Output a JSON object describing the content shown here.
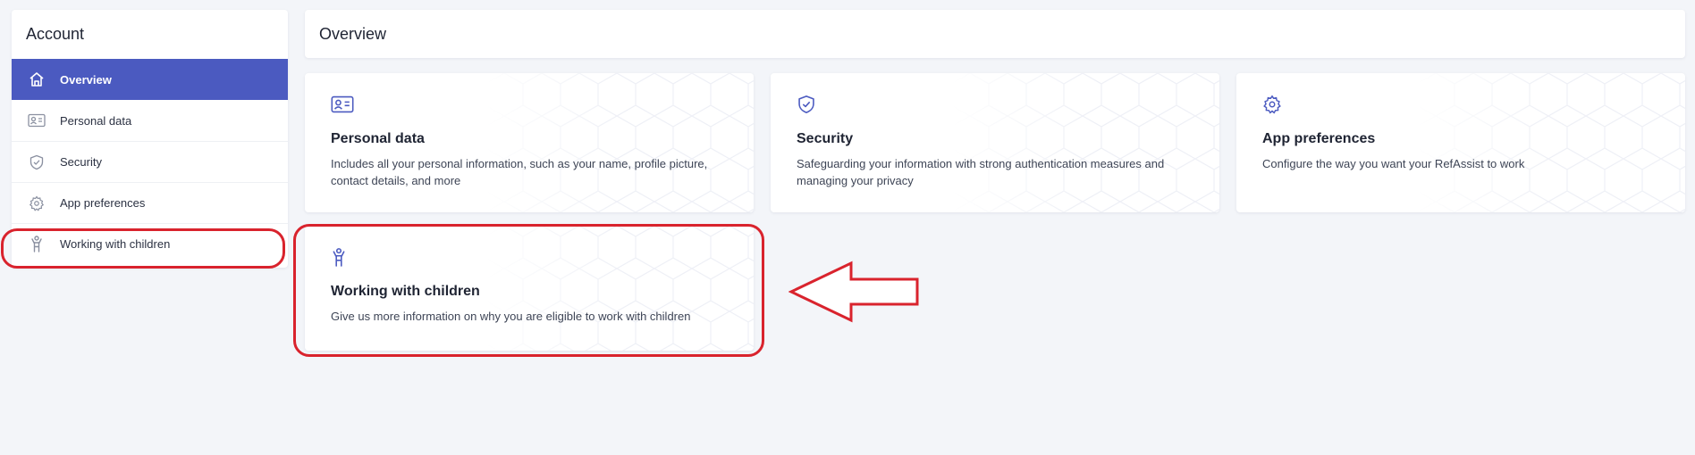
{
  "sidebar": {
    "title": "Account",
    "items": [
      {
        "label": "Overview",
        "icon": "home-icon",
        "active": true
      },
      {
        "label": "Personal data",
        "icon": "id-card-icon",
        "active": false
      },
      {
        "label": "Security",
        "icon": "shield-check-icon",
        "active": false
      },
      {
        "label": "App preferences",
        "icon": "gear-icon",
        "active": false
      },
      {
        "label": "Working with children",
        "icon": "child-icon",
        "active": false
      }
    ]
  },
  "header": {
    "title": "Overview"
  },
  "cards": [
    {
      "title": "Personal data",
      "description": "Includes all your personal information, such as your name, profile picture, contact details, and more",
      "icon": "id-card-icon"
    },
    {
      "title": "Security",
      "description": "Safeguarding your information with strong authentication measures and managing your privacy",
      "icon": "shield-check-icon"
    },
    {
      "title": "App preferences",
      "description": "Configure the way you want your RefAssist to work",
      "icon": "gear-icon"
    },
    {
      "title": "Working with children",
      "description": "Give us more information on why you are eligible to work with children",
      "icon": "child-icon"
    }
  ],
  "colors": {
    "accent": "#4b5ac0",
    "annotation": "#d9232d",
    "background": "#f3f5f9"
  }
}
